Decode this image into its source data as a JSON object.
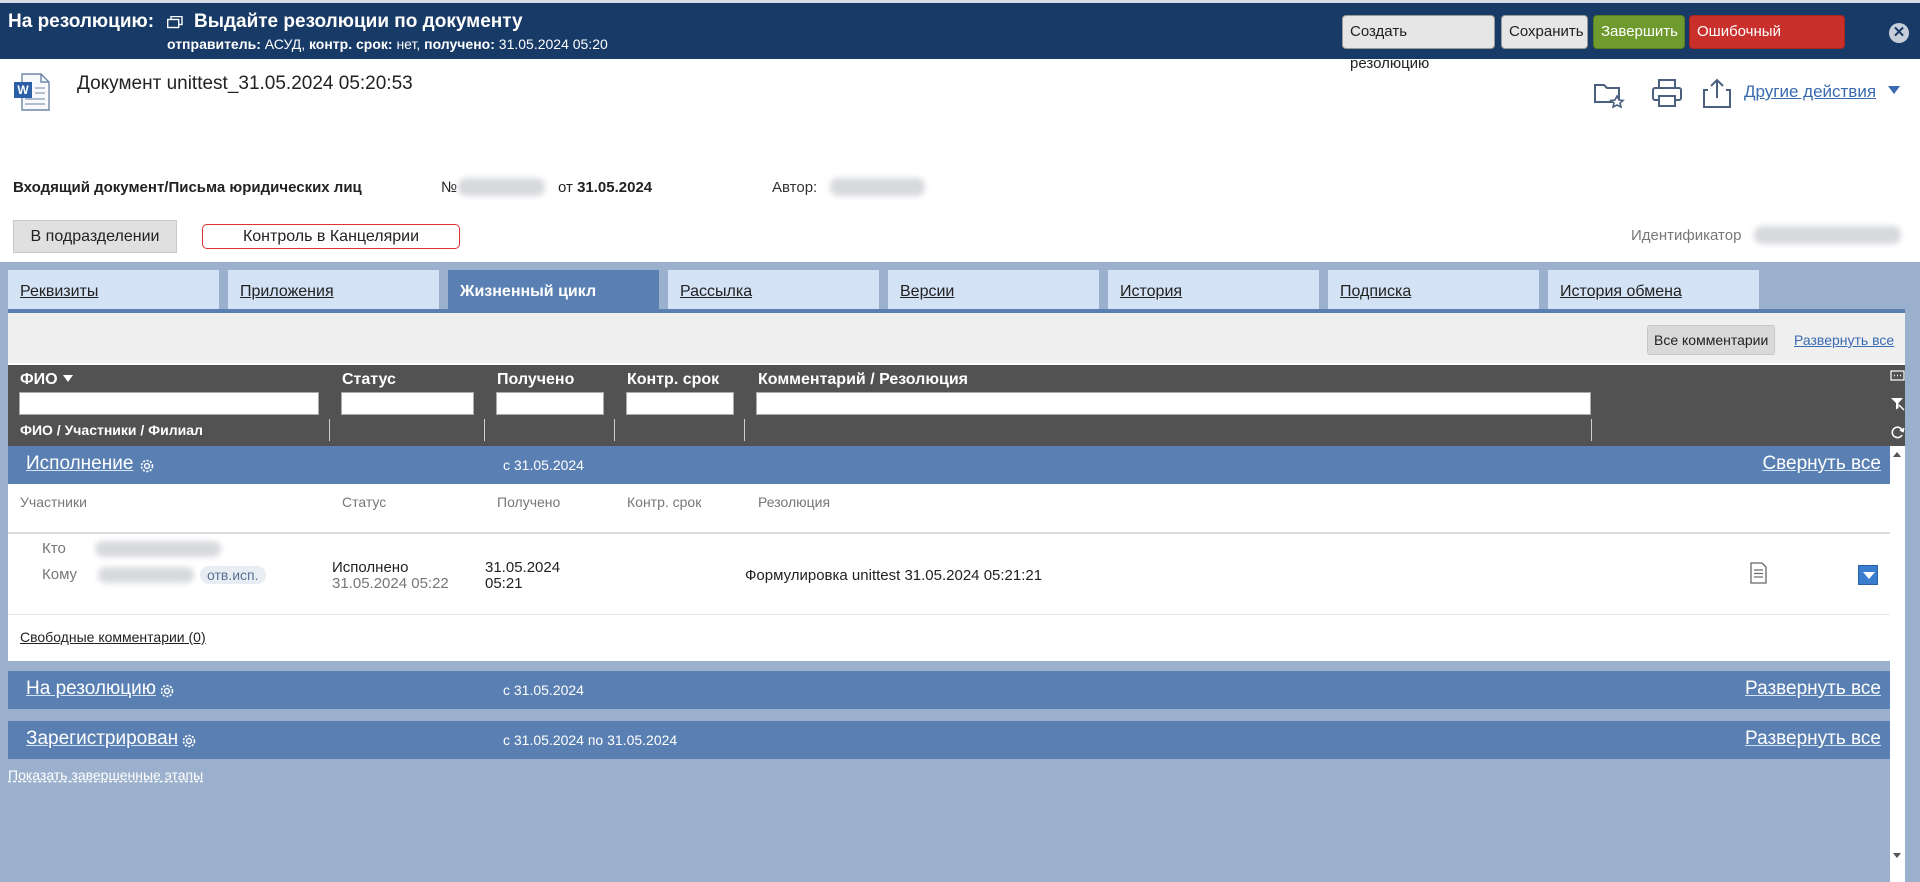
{
  "topbar": {
    "label": "На резолюцию:",
    "task_title": "Выдайте резолюции по документу",
    "meta": {
      "sender_label": "отправитель:",
      "sender": "АСУД,",
      "deadline_label": "контр. срок:",
      "deadline": "нет,",
      "received_label": "получено:",
      "received": "31.05.2024 05:20"
    },
    "buttons": {
      "create_resolution": "Создать резолюцию",
      "save": "Сохранить",
      "finish": "Завершить",
      "wrong_addressee": "Ошибочный адресат"
    },
    "close_icon": "close-icon"
  },
  "document": {
    "title": "Документ unittest_31.05.2024 05:20:53",
    "type": "Входящий документ/Письма юридических лиц",
    "number_label": "№",
    "date_prefix": "от",
    "date": "31.05.2024",
    "author_label": "Автор:",
    "other_actions": "Другие действия",
    "dept_button": "В подразделении",
    "control_button": "Контроль в Канцелярии",
    "identifier_label": "Идентификатор"
  },
  "tabs": [
    {
      "label": "Реквизиты",
      "active": false
    },
    {
      "label": "Приложения",
      "active": false
    },
    {
      "label": "Жизненный цикл",
      "active": true
    },
    {
      "label": "Рассылка",
      "active": false
    },
    {
      "label": "Версии",
      "active": false
    },
    {
      "label": "История",
      "active": false
    },
    {
      "label": "Подписка",
      "active": false
    },
    {
      "label": "История обмена",
      "active": false
    }
  ],
  "toolbar": {
    "all_comments": "Все комментарии",
    "expand_all": "Развернуть все"
  },
  "filter": {
    "columns": {
      "fio": "ФИО",
      "status": "Статус",
      "received": "Получено",
      "deadline": "Контр. срок",
      "comment": "Комментарий / Резолюция"
    },
    "sub": "ФИО / Участники / Филиал"
  },
  "stages": [
    {
      "name": "Исполнение",
      "since": "с 31.05.2024",
      "toggle": "Свернуть все"
    },
    {
      "name": "На резолюцию",
      "since": "с 31.05.2024",
      "toggle": "Развернуть все"
    },
    {
      "name": "Зарегистрирован",
      "since": "с 31.05.2024 по 31.05.2024",
      "toggle": "Развернуть все"
    }
  ],
  "rows_head": {
    "participants": "Участники",
    "status": "Статус",
    "received": "Получено",
    "deadline": "Контр. срок",
    "resolution": "Резолюция"
  },
  "row": {
    "who_label": "Кто",
    "to_label": "Кому",
    "responsible_badge": "отв.исп.",
    "status": "Исполнено",
    "status_time": "31.05.2024 05:22",
    "received_date": "31.05.2024",
    "received_time": "05:21",
    "resolution": "Формулировка unittest 31.05.2024 05:21:21"
  },
  "free_comments": "Свободные комментарии (0)",
  "show_finished": "Показать завершенные этапы"
}
